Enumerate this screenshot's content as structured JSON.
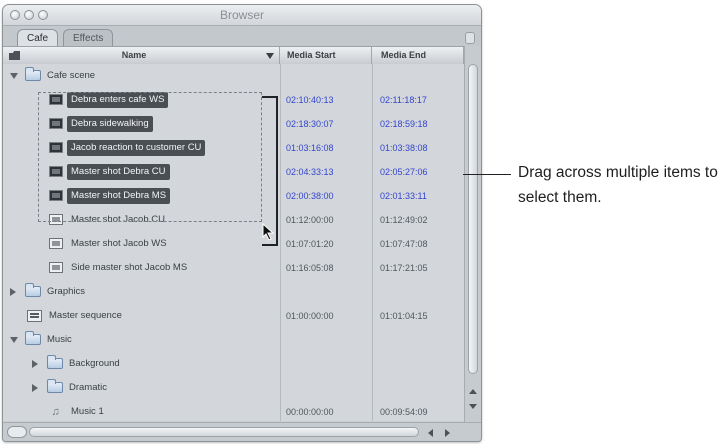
{
  "window": {
    "title": "Browser"
  },
  "tabs": [
    {
      "label": "Cafe",
      "active": true
    },
    {
      "label": "Effects",
      "active": false
    }
  ],
  "columns": {
    "name": "Name",
    "media_start": "Media Start",
    "media_end": "Media End"
  },
  "rows": [
    {
      "name": "Cafe scene",
      "type": "folder",
      "disclosure": "down",
      "indent": 0,
      "selected": false,
      "media_start": "",
      "media_end": ""
    },
    {
      "name": "Debra enters cafe WS",
      "type": "clip",
      "indent": 1,
      "selected": true,
      "media_start": "02:10:40:13",
      "media_end": "02:11:18:17"
    },
    {
      "name": "Debra sidewalking",
      "type": "clip",
      "indent": 1,
      "selected": true,
      "media_start": "02:18:30:07",
      "media_end": "02:18:59:18"
    },
    {
      "name": "Jacob reaction to customer CU",
      "type": "clip",
      "indent": 1,
      "selected": true,
      "media_start": "01:03:16:08",
      "media_end": "01:03:38:08"
    },
    {
      "name": "Master shot Debra CU",
      "type": "clip",
      "indent": 1,
      "selected": true,
      "media_start": "02:04:33:13",
      "media_end": "02:05:27:06"
    },
    {
      "name": "Master shot Debra MS",
      "type": "clip",
      "indent": 1,
      "selected": true,
      "media_start": "02:00:38:00",
      "media_end": "02:01:33:11"
    },
    {
      "name": "Master shot Jacob CU",
      "type": "clip",
      "indent": 1,
      "selected": false,
      "media_start": "01:12:00:00",
      "media_end": "01:12:49:02"
    },
    {
      "name": "Master shot Jacob WS",
      "type": "clip",
      "indent": 1,
      "selected": false,
      "media_start": "01:07:01:20",
      "media_end": "01:07:47:08"
    },
    {
      "name": "Side master shot Jacob MS",
      "type": "clip",
      "indent": 1,
      "selected": false,
      "media_start": "01:16:05:08",
      "media_end": "01:17:21:05"
    },
    {
      "name": "Graphics",
      "type": "folder",
      "disclosure": "right",
      "indent": 0,
      "selected": false,
      "media_start": "",
      "media_end": ""
    },
    {
      "name": "Master sequence",
      "type": "sequence",
      "indent": 0,
      "selected": false,
      "media_start": "01:00:00:00",
      "media_end": "01:01:04:15"
    },
    {
      "name": "Music",
      "type": "folder",
      "disclosure": "down",
      "indent": 0,
      "selected": false,
      "media_start": "",
      "media_end": ""
    },
    {
      "name": "Background",
      "type": "folder",
      "disclosure": "right",
      "indent": 1,
      "selected": false,
      "media_start": "",
      "media_end": ""
    },
    {
      "name": "Dramatic",
      "type": "folder",
      "disclosure": "right",
      "indent": 1,
      "selected": false,
      "media_start": "",
      "media_end": ""
    },
    {
      "name": "Music 1",
      "type": "audio",
      "indent": 1,
      "selected": false,
      "media_start": "00:00:00:00",
      "media_end": "00:09:54:09"
    }
  ],
  "callout": {
    "text": "Drag across multiple items to select them."
  },
  "colors": {
    "selection": "#4a4f54",
    "timecode_blue": "#3344cc",
    "list_background": "#d3d7db"
  }
}
